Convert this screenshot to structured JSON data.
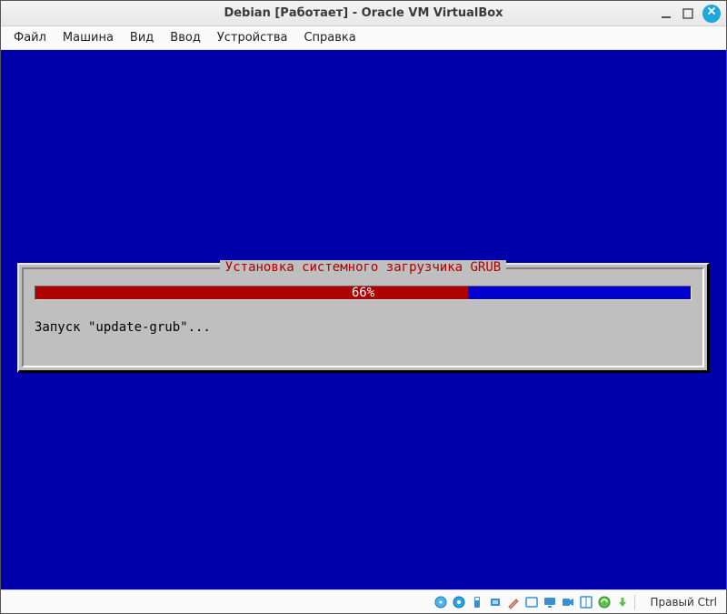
{
  "window": {
    "title": "Debian [Работает] - Oracle VM VirtualBox"
  },
  "menubar": {
    "items": [
      "Файл",
      "Машина",
      "Вид",
      "Ввод",
      "Устройства",
      "Справка"
    ]
  },
  "installer": {
    "title": "Установка системного загрузчика GRUB",
    "progress_pct_text": "66%",
    "progress_pct": 66,
    "status": "Запуск \"update-grub\"..."
  },
  "statusbar": {
    "hostkey": "Правый Ctrl",
    "icons": [
      "hard-disk-icon",
      "optical-disk-icon",
      "usb-icon",
      "audio-icon",
      "pen-icon",
      "shared-folder-icon",
      "display-icon",
      "recording-icon",
      "video-capture-icon",
      "mouse-integration-icon",
      "keyboard-icon"
    ]
  },
  "colors": {
    "vm_bg": "#0000aa",
    "progress_fill": "#b00000",
    "progress_track": "#0000d0",
    "box_bg": "#bfbfbf",
    "title_red": "#b00000",
    "close_blue": "#1fa7e0"
  }
}
